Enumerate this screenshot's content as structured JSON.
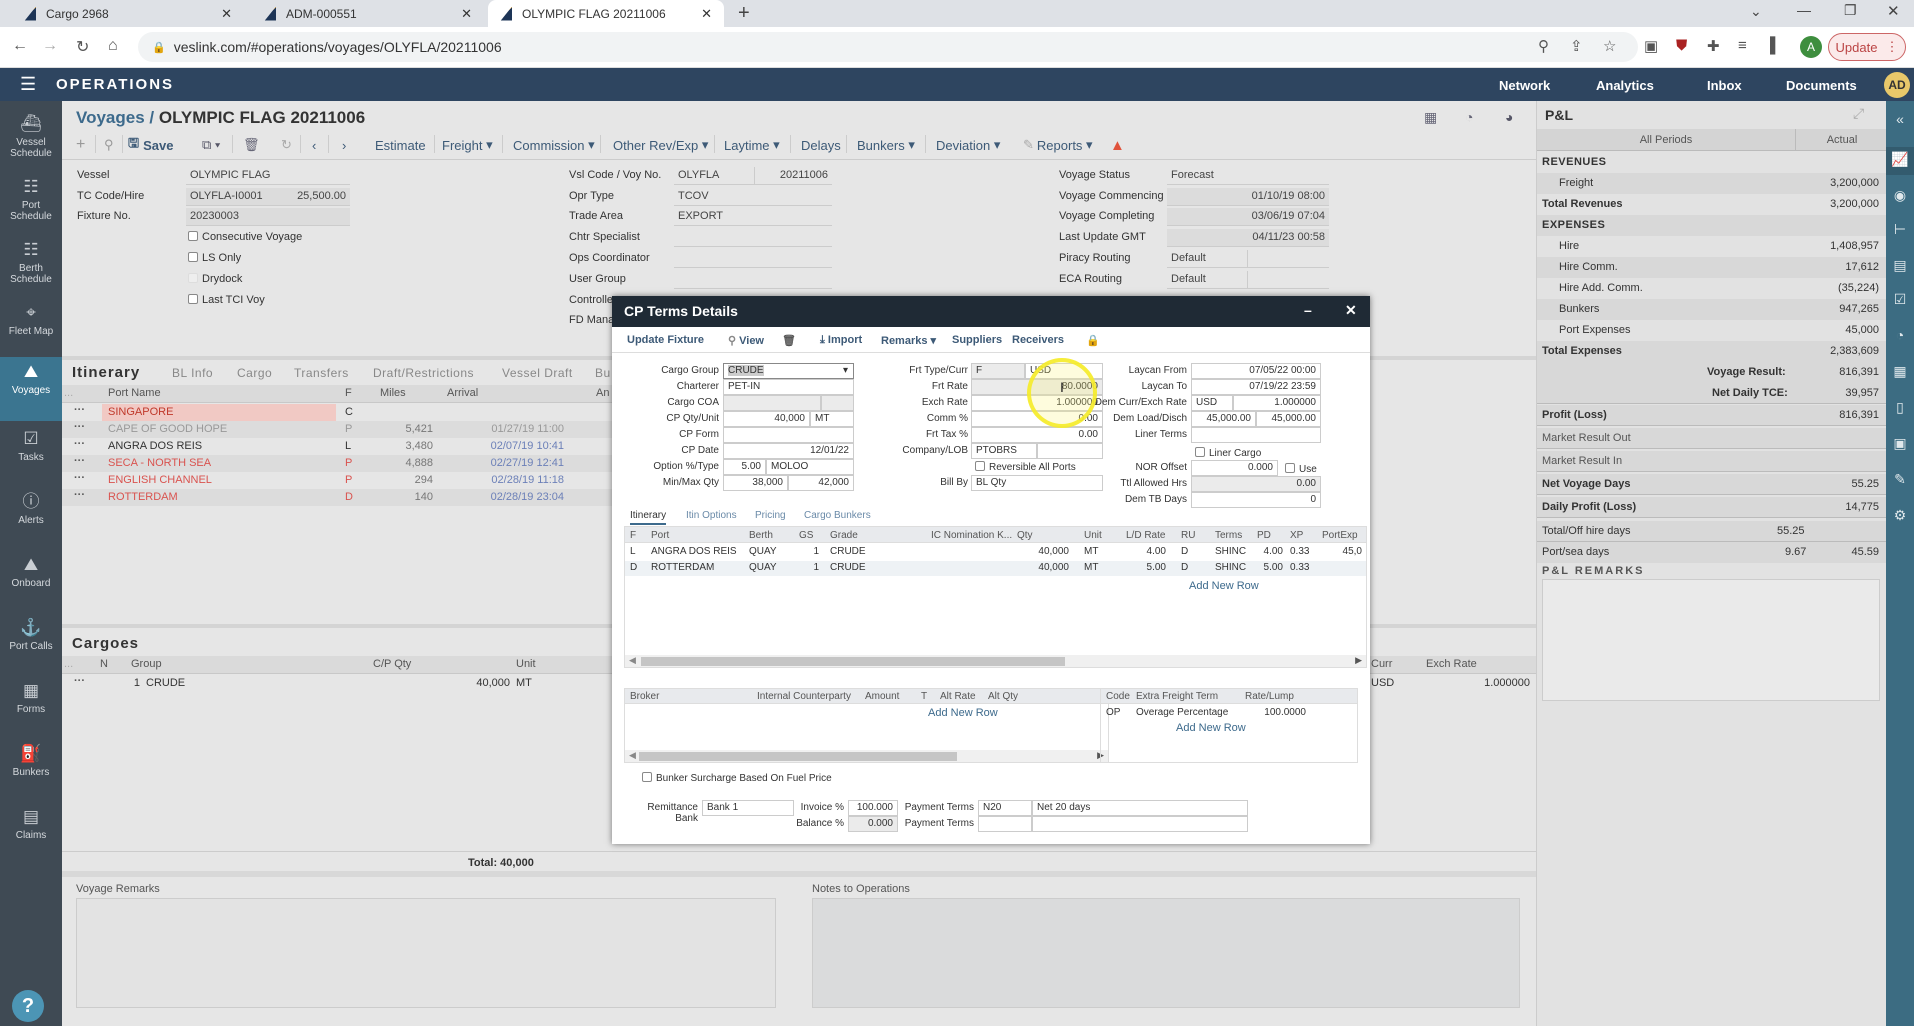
{
  "browser": {
    "tabs": [
      {
        "title": "Cargo 2968",
        "active": false
      },
      {
        "title": "ADM-000551",
        "active": false
      },
      {
        "title": "OLYMPIC FLAG 20211006",
        "active": true
      }
    ],
    "url": "veslink.com/#operations/voyages/OLYFLA/20211006",
    "update_label": "Update",
    "profile_initial": "A"
  },
  "app": {
    "title": "OPERATIONS",
    "top_nav": [
      "Network",
      "Analytics",
      "Inbox",
      "Documents"
    ],
    "user_initials": "AD"
  },
  "left_nav": [
    {
      "label": "Vessel Schedule",
      "icon": "ship-icon"
    },
    {
      "label": "Port Schedule",
      "icon": "port-schedule-icon"
    },
    {
      "label": "Berth Schedule",
      "icon": "berth-schedule-icon"
    },
    {
      "label": "Fleet Map",
      "icon": "map-icon"
    },
    {
      "label": "Voyages",
      "icon": "voyages-icon",
      "active": true
    },
    {
      "label": "Tasks",
      "icon": "tasks-icon"
    },
    {
      "label": "Alerts",
      "icon": "alert-icon"
    },
    {
      "label": "Onboard",
      "icon": "onboard-icon"
    },
    {
      "label": "Port Calls",
      "icon": "anchor-icon"
    },
    {
      "label": "Forms",
      "icon": "forms-icon"
    },
    {
      "label": "Bunkers",
      "icon": "fuel-icon"
    },
    {
      "label": "Claims",
      "icon": "claims-icon"
    }
  ],
  "page": {
    "breadcrumb_root": "Voyages /",
    "title": "OLYMPIC FLAG 20211006",
    "toolbar": {
      "save": "Save",
      "estimate": "Estimate",
      "freight": "Freight",
      "commission": "Commission",
      "other_rev_exp": "Other Rev/Exp",
      "laytime": "Laytime",
      "delays": "Delays",
      "bunkers": "Bunkers",
      "deviation": "Deviation",
      "reports": "Reports"
    }
  },
  "voyage_header": {
    "vessel_label": "Vessel",
    "vessel": "OLYMPIC FLAG",
    "tc_label": "TC Code/Hire",
    "tc_code": "OLYFLA-I0001",
    "hire": "25,500.00",
    "fixture_label": "Fixture No.",
    "fixture": "20230003",
    "checkboxes": [
      "Consecutive Voyage",
      "LS Only",
      "Drydock",
      "Last TCI Voy"
    ],
    "vsl_code_label": "Vsl Code / Voy No.",
    "vsl_code": "OLYFLA",
    "voy_no": "20211006",
    "opr_type_label": "Opr Type",
    "opr_type": "TCOV",
    "trade_area_label": "Trade Area",
    "trade_area": "EXPORT",
    "chtr_specialist_label": "Chtr Specialist",
    "ops_coordinator_label": "Ops Coordinator",
    "user_group_label": "User Group",
    "controller_label": "Controller",
    "fd_manager_label": "FD Manager",
    "status_label": "Voyage Status",
    "status": "Forecast",
    "commencing_label": "Voyage Commencing",
    "commencing": "01/10/19 08:00",
    "completing_label": "Voyage Completing",
    "completing": "03/06/19 07:04",
    "last_update_label": "Last Update GMT",
    "last_update": "04/11/23 00:58",
    "piracy_label": "Piracy Routing",
    "piracy": "Default",
    "eca_label": "ECA Routing",
    "eca": "Default"
  },
  "itinerary": {
    "title": "Itinerary",
    "tabs": [
      "BL Info",
      "Cargo",
      "Transfers",
      "Draft/Restrictions",
      "Vessel Draft",
      "Bu"
    ],
    "columns": [
      "Port Name",
      "F",
      "Miles",
      "Arrival",
      "An"
    ],
    "rows": [
      {
        "port": "SINGAPORE",
        "f": "C",
        "miles": "",
        "arrival": "",
        "style": "highlight"
      },
      {
        "port": "CAPE OF GOOD HOPE",
        "f": "P",
        "miles": "5,421",
        "arrival": "01/27/19 11:00",
        "style": "grey"
      },
      {
        "port": "ANGRA DOS REIS",
        "f": "L",
        "miles": "3,480",
        "arrival": "02/07/19 10:41",
        "style": "normal"
      },
      {
        "port": "SECA - NORTH SEA",
        "f": "P",
        "miles": "4,888",
        "arrival": "02/27/19 12:41",
        "style": "red"
      },
      {
        "port": "ENGLISH CHANNEL",
        "f": "P",
        "miles": "294",
        "arrival": "02/28/19 11:18",
        "style": "red"
      },
      {
        "port": "ROTTERDAM",
        "f": "D",
        "miles": "140",
        "arrival": "02/28/19 23:04",
        "style": "red"
      }
    ]
  },
  "cargoes": {
    "title": "Cargoes",
    "columns": [
      "N",
      "Group",
      "C/P Qty",
      "Unit",
      "Curr",
      "Exch Rate"
    ],
    "rows": [
      {
        "n": "1",
        "group": "CRUDE",
        "qty": "40,000",
        "unit": "MT",
        "curr": "USD",
        "exch": "1.000000"
      }
    ],
    "total": "Total: 40,000"
  },
  "remarks": {
    "voyage_remarks_label": "Voyage Remarks",
    "notes_label": "Notes to Operations"
  },
  "pl": {
    "title": "P&L",
    "col_periods": "All Periods",
    "col_actual": "Actual",
    "rows": [
      {
        "name": "REVENUES",
        "value": "",
        "kind": "section"
      },
      {
        "name": "Freight",
        "value": "3,200,000",
        "kind": "item"
      },
      {
        "name": "Total Revenues",
        "value": "3,200,000",
        "kind": "total"
      },
      {
        "name": "EXPENSES",
        "value": "",
        "kind": "section"
      },
      {
        "name": "Hire",
        "value": "1,408,957",
        "kind": "item"
      },
      {
        "name": "Hire Comm.",
        "value": "17,612",
        "kind": "item"
      },
      {
        "name": "Hire Add. Comm.",
        "value": "(35,224)",
        "kind": "item"
      },
      {
        "name": "Bunkers",
        "value": "947,265",
        "kind": "item"
      },
      {
        "name": "Port Expenses",
        "value": "45,000",
        "kind": "item"
      },
      {
        "name": "Total Expenses",
        "value": "2,383,609",
        "kind": "total"
      }
    ],
    "voyage_result_label": "Voyage Result:",
    "voyage_result": "816,391",
    "net_tce_label": "Net Daily TCE:",
    "net_tce": "39,957",
    "summary": [
      {
        "name": "Profit (Loss)",
        "value": "816,391"
      },
      {
        "name": "Market Result Out",
        "value": ""
      },
      {
        "name": "Market Result In",
        "value": ""
      },
      {
        "name": "Net Voyage Days",
        "value": "55.25"
      },
      {
        "name": "Daily Profit (Loss)",
        "value": "14,775"
      }
    ],
    "total_off_hire_label": "Total/Off hire days",
    "total_off_hire": "55.25",
    "port_sea_label": "Port/sea days",
    "port_days": "9.67",
    "sea_days": "45.59",
    "remarks_title": "P&L REMARKS"
  },
  "modal": {
    "title": "CP Terms Details",
    "toolbar": {
      "update_fixture": "Update Fixture",
      "view": "View",
      "import": "Import",
      "remarks": "Remarks",
      "suppliers": "Suppliers",
      "receivers": "Receivers"
    },
    "left": {
      "cargo_group_label": "Cargo Group",
      "cargo_group": "CRUDE",
      "charterer_label": "Charterer",
      "charterer": "PET-IN",
      "cargo_coa_label": "Cargo COA",
      "cp_qty_label": "CP Qty/Unit",
      "cp_qty": "40,000",
      "cp_unit": "MT",
      "cp_form_label": "CP Form",
      "cp_date_label": "CP Date",
      "cp_date": "12/01/22",
      "option_label": "Option %/Type",
      "option_pct": "5.00",
      "option_type": "MOLOO",
      "minmax_label": "Min/Max Qty",
      "min_qty": "38,000",
      "max_qty": "42,000"
    },
    "mid": {
      "frt_type_label": "Frt Type/Curr",
      "frt_type": "F",
      "frt_curr": "USD",
      "frt_rate_label": "Frt Rate",
      "frt_rate": "80.0000",
      "exch_rate_label": "Exch Rate",
      "exch_rate": "1.000000",
      "comm_label": "Comm %",
      "comm": "0.00",
      "frt_tax_label": "Frt Tax %",
      "frt_tax": "0.00",
      "company_label": "Company/LOB",
      "company": "PTOBRS",
      "reversible_label": "Reversible All Ports",
      "bill_by_label": "Bill By",
      "bill_by": "BL Qty"
    },
    "right": {
      "laycan_from_label": "Laycan From",
      "laycan_from": "07/05/22 00:00",
      "laycan_to_label": "Laycan To",
      "laycan_to": "07/19/22 23:59",
      "dem_curr_label": "Dem Curr/Exch Rate",
      "dem_curr": "USD",
      "dem_exch": "1.000000",
      "dem_load_label": "Dem Load/Disch",
      "dem_load": "45,000.00",
      "dem_disch": "45,000.00",
      "liner_terms_label": "Liner Terms",
      "liner_cargo_label": "Liner Cargo",
      "nor_offset_label": "NOR Offset",
      "nor_offset": "0.000",
      "use_label": "Use",
      "ttl_allowed_label": "Ttl Allowed Hrs",
      "ttl_allowed": "0.00",
      "dem_tb_label": "Dem TB Days",
      "dem_tb": "0"
    },
    "tabs": [
      "Itinerary",
      "Itin Options",
      "Pricing",
      "Cargo Bunkers"
    ],
    "itin_columns": [
      "F",
      "Port",
      "Berth",
      "GS",
      "Grade",
      "IC Nomination K...",
      "Qty",
      "Unit",
      "L/D Rate",
      "RU",
      "Terms",
      "PD",
      "XP",
      "PortExp"
    ],
    "itin_rows": [
      {
        "f": "L",
        "port": "ANGRA DOS REIS",
        "berth": "QUAY",
        "gs": "1",
        "grade": "CRUDE",
        "ic": "",
        "qty": "40,000",
        "unit": "MT",
        "ld": "4.00",
        "ru": "D",
        "terms": "SHINC",
        "pd": "4.00",
        "xp": "0.33",
        "portexp": "45,0"
      },
      {
        "f": "D",
        "port": "ROTTERDAM",
        "berth": "QUAY",
        "gs": "1",
        "grade": "CRUDE",
        "ic": "",
        "qty": "40,000",
        "unit": "MT",
        "ld": "5.00",
        "ru": "D",
        "terms": "SHINC",
        "pd": "5.00",
        "xp": "0.33",
        "portexp": ""
      }
    ],
    "add_new_row": "Add New Row",
    "broker_columns": [
      "Broker",
      "Internal Counterparty",
      "Amount",
      "T",
      "Alt Rate",
      "Alt Qty"
    ],
    "eft_columns": [
      "Code",
      "Extra Freight Term",
      "Rate/Lump"
    ],
    "eft_rows": [
      {
        "code": "OP",
        "term": "Overage Percentage",
        "rate": "100.0000"
      }
    ],
    "bunker_surcharge_label": "Bunker Surcharge Based On Fuel Price",
    "remit_bank_label": "Remittance Bank",
    "remit_bank": "Bank 1",
    "invoice_label": "Invoice %",
    "invoice": "100.000",
    "balance_label": "Balance %",
    "balance": "0.000",
    "pay_terms_label": "Payment Terms",
    "pay_terms_code": "N20",
    "pay_terms_desc": "Net 20 days",
    "pay_terms2_label": "Payment Terms"
  }
}
